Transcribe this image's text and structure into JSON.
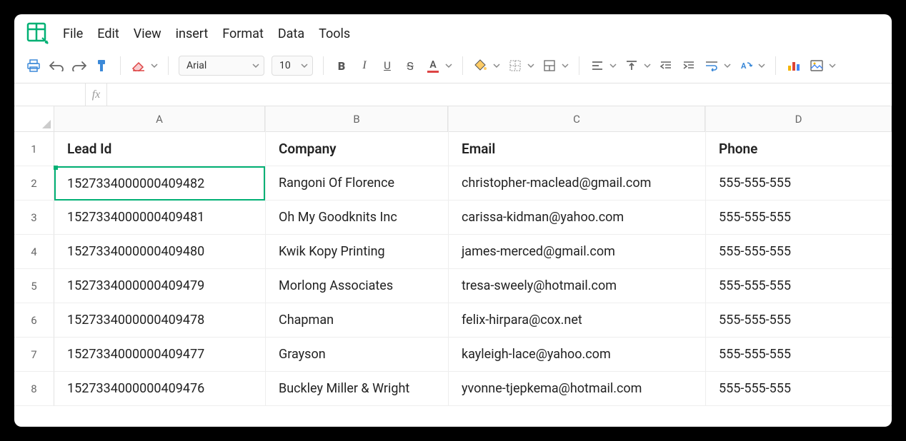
{
  "menu": {
    "items": [
      "File",
      "Edit",
      "View",
      "insert",
      "Format",
      "Data",
      "Tools"
    ]
  },
  "toolbar": {
    "font_name": "Arial",
    "font_size": "10"
  },
  "namebox": "",
  "formula": "",
  "col_letters": [
    "A",
    "B",
    "C",
    "D"
  ],
  "row_numbers": [
    "1",
    "2",
    "3",
    "4",
    "5",
    "6",
    "7",
    "8"
  ],
  "headers": [
    "Lead Id",
    "Company",
    "Email",
    "Phone"
  ],
  "rows": [
    {
      "lead": "1527334000000409482",
      "company": "Rangoni Of Florence",
      "email": "christopher-maclead@gmail.com",
      "phone": "555-555-555"
    },
    {
      "lead": "1527334000000409481",
      "company": "Oh My Goodknits Inc",
      "email": "carissa-kidman@yahoo.com",
      "phone": "555-555-555"
    },
    {
      "lead": "1527334000000409480",
      "company": "Kwik Kopy Printing",
      "email": "james-merced@gmail.com",
      "phone": "555-555-555"
    },
    {
      "lead": "1527334000000409479",
      "company": "Morlong Associates",
      "email": "tresa-sweely@hotmail.com",
      "phone": "555-555-555"
    },
    {
      "lead": "1527334000000409478",
      "company": "Chapman",
      "email": "felix-hirpara@cox.net",
      "phone": "555-555-555"
    },
    {
      "lead": "1527334000000409477",
      "company": "Grayson",
      "email": "kayleigh-lace@yahoo.com",
      "phone": "555-555-555"
    },
    {
      "lead": "1527334000000409476",
      "company": "Buckley Miller & Wright",
      "email": "yvonne-tjepkema@hotmail.com",
      "phone": "555-555-555"
    }
  ],
  "selected": {
    "col": "A",
    "row": 2
  }
}
